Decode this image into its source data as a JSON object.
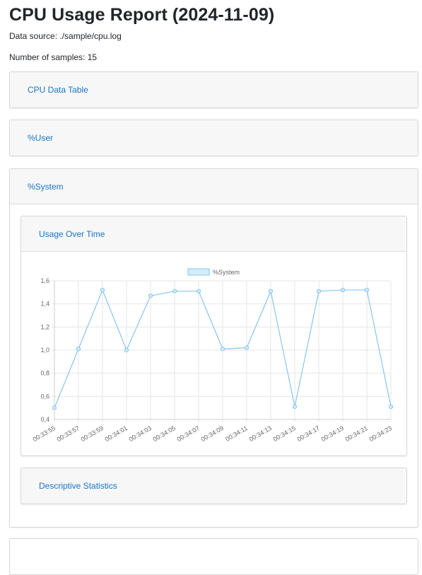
{
  "report": {
    "title": "CPU Usage Report (2024-11-09)",
    "data_source": "Data source: ./sample/cpu.log",
    "samples": "Number of samples: 15"
  },
  "sections": {
    "cpu_table": "CPU Data Table",
    "user": "%User",
    "system": "%System",
    "usage_over_time": "Usage Over Time",
    "descriptive_stats": "Descriptive Statistics"
  },
  "colors": {
    "link": "#1a73c7",
    "line": "#87c5ec",
    "fill": "#d3ebfa"
  },
  "chart_data": {
    "type": "line",
    "title": "",
    "xlabel": "",
    "ylabel": "",
    "legend": "top-center",
    "grid": true,
    "ylim": [
      0.4,
      1.6
    ],
    "yticks": [
      "0,4",
      "0,6",
      "0,8",
      "1,0",
      "1,2",
      "1,4",
      "1,6"
    ],
    "categories": [
      "00:33:55",
      "00:33:57",
      "00:33:59",
      "00:34:01",
      "00:34:03",
      "00:34:05",
      "00:34:07",
      "00:34:09",
      "00:34:11",
      "00:34:13",
      "00:34:15",
      "00:34:17",
      "00:34:19",
      "00:34:21",
      "00:34:23"
    ],
    "series": [
      {
        "name": "%System",
        "values": [
          0.5,
          1.01,
          1.52,
          1.0,
          1.47,
          1.51,
          1.51,
          1.01,
          1.02,
          1.51,
          0.51,
          1.51,
          1.52,
          1.52,
          0.51
        ]
      }
    ]
  }
}
